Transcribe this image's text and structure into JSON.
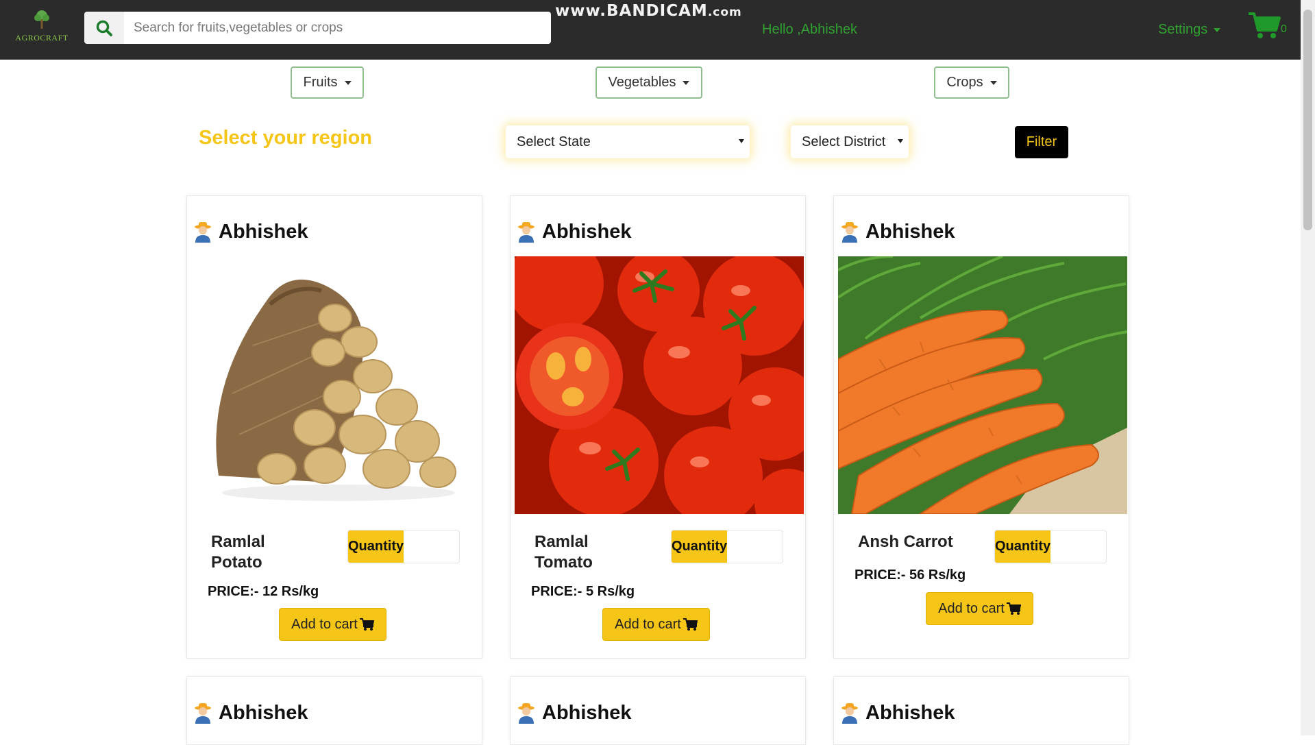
{
  "header": {
    "logo_text": "AGROCRAFT",
    "search_placeholder": "Search for fruits,vegetables or crops",
    "watermark_main": "www.BANDICAM",
    "watermark_suffix": ".com",
    "greeting": "Hello ,Abhishek",
    "settings_label": "Settings",
    "cart_count": "0"
  },
  "categories": [
    "Fruits",
    "Vegetables",
    "Crops"
  ],
  "region": {
    "title": "Select your region",
    "state_placeholder": "Select State",
    "district_placeholder": "Select District",
    "filter_label": "Filter"
  },
  "products": [
    {
      "seller": "Abhishek",
      "name_line1": "Ramlal",
      "name_line2": "Potato",
      "quantity_label": "Quantity",
      "price": "PRICE:- 12 Rs/kg",
      "add_label": "Add to cart"
    },
    {
      "seller": "Abhishek",
      "name_line1": "Ramlal",
      "name_line2": "Tomato",
      "quantity_label": "Quantity",
      "price": "PRICE:- 5 Rs/kg",
      "add_label": "Add to cart"
    },
    {
      "seller": "Abhishek",
      "name_line1": "Ansh Carrot",
      "name_line2": "",
      "quantity_label": "Quantity",
      "price": "PRICE:- 56 Rs/kg",
      "add_label": "Add to cart"
    }
  ],
  "second_row_sellers": [
    "Abhishek",
    "Abhishek",
    "Abhishek"
  ],
  "colors": {
    "navbar": "#2b2b2b",
    "accent_yellow": "#f5c518",
    "accent_green": "#2fa32f"
  }
}
